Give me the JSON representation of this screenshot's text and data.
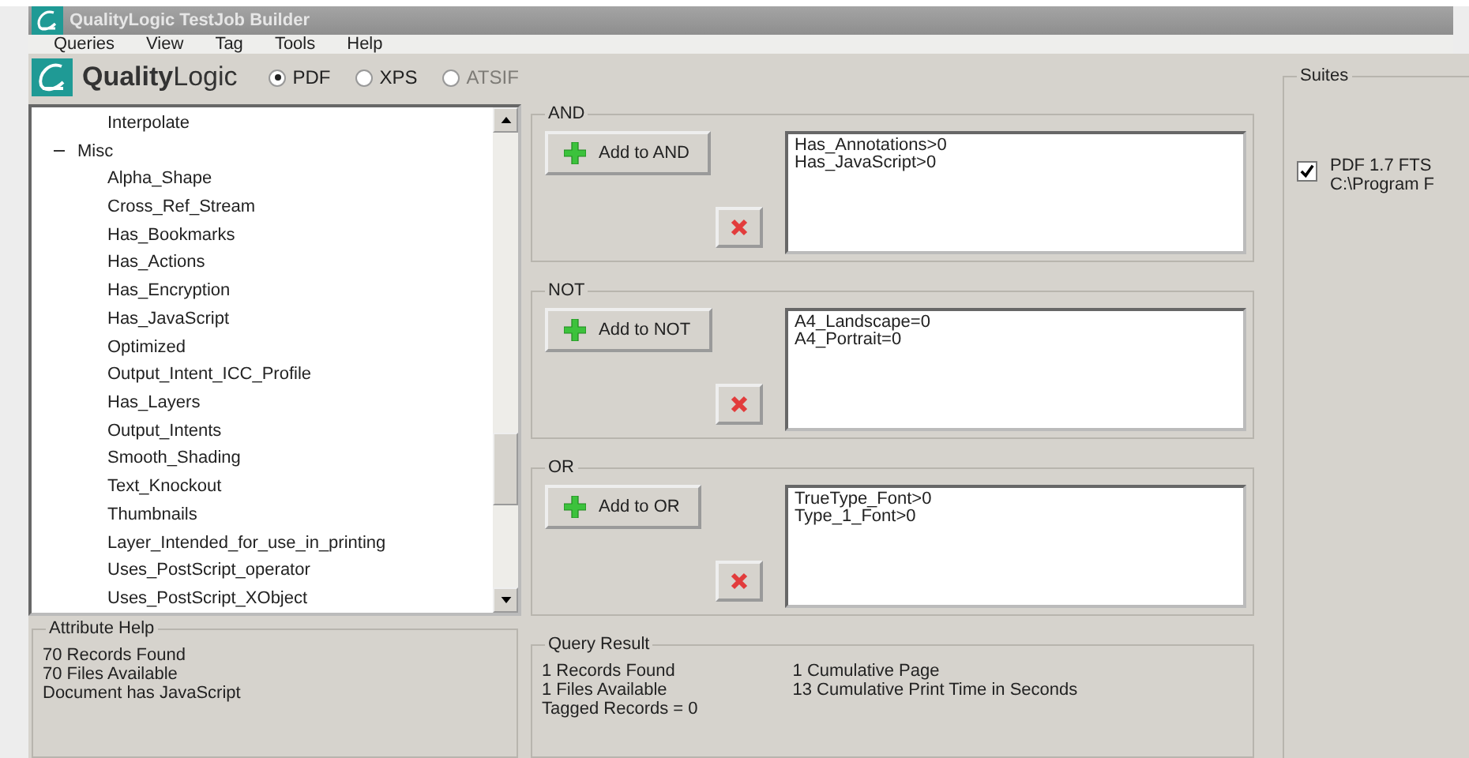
{
  "window": {
    "title": "QualityLogic TestJob Builder"
  },
  "menu": [
    "Queries",
    "View",
    "Tag",
    "Tools",
    "Help"
  ],
  "logo": {
    "text": "**Quality**Logic"
  },
  "formats": [
    {
      "label": "PDF",
      "selected": true,
      "disabled": false
    },
    {
      "label": "XPS",
      "selected": false,
      "disabled": false
    },
    {
      "label": "ATSIF",
      "selected": false,
      "disabled": true
    }
  ],
  "tree": [
    {
      "children": [
        {
          "label": "Interpolate"
        }
      ]
    },
    {
      "label": "Misc",
      "expanded": true,
      "children": [
        {
          "label": "Alpha_Shape"
        },
        {
          "label": "Cross_Ref_Stream"
        },
        {
          "label": "Has_Bookmarks"
        },
        {
          "label": "Has_Actions"
        },
        {
          "label": "Has_Encryption"
        },
        {
          "label": "Has_JavaScript"
        },
        {
          "label": "Optimized"
        },
        {
          "label": "Output_Intent_ICC_Profile"
        },
        {
          "label": "Has_Layers"
        },
        {
          "label": "Output_Intents"
        },
        {
          "label": "Smooth_Shading"
        },
        {
          "label": "Text_Knockout"
        },
        {
          "label": "Thumbnails"
        },
        {
          "label": "Layer_Intended_for_use_in_printing"
        },
        {
          "label": "Uses_PostScript_operator"
        },
        {
          "label": "Uses_PostScript_XObject"
        }
      ]
    }
  ],
  "attribute_help": {
    "title": "Attribute Help",
    "lines": [
      "70 Records Found",
      "70 Files Available",
      "Document has JavaScript"
    ]
  },
  "groups": [
    {
      "title": "AND",
      "button": "Add to AND",
      "items": [
        "Has_Annotations>0",
        "Has_JavaScript>0"
      ]
    },
    {
      "title": "NOT",
      "button": "Add to NOT",
      "items": [
        "A4_Landscape=0",
        "A4_Portrait=0"
      ]
    },
    {
      "title": "OR",
      "button": "Add to OR",
      "items": [
        "TrueType_Font>0",
        "Type_1_Font>0"
      ]
    }
  ],
  "query_result": {
    "title": "Query Result",
    "column_1": [
      "1 Records Found",
      "1 Files Available",
      "Tagged Records = 0"
    ],
    "column_2": [
      "1 Cumulative Page",
      "13 Cumulative Print Time in Seconds"
    ]
  },
  "suites": {
    "title": "Suites",
    "items": [
      {
        "name": "PDF 1.7 FTS",
        "path": "C:\\Program F",
        "checked": true
      }
    ]
  }
}
